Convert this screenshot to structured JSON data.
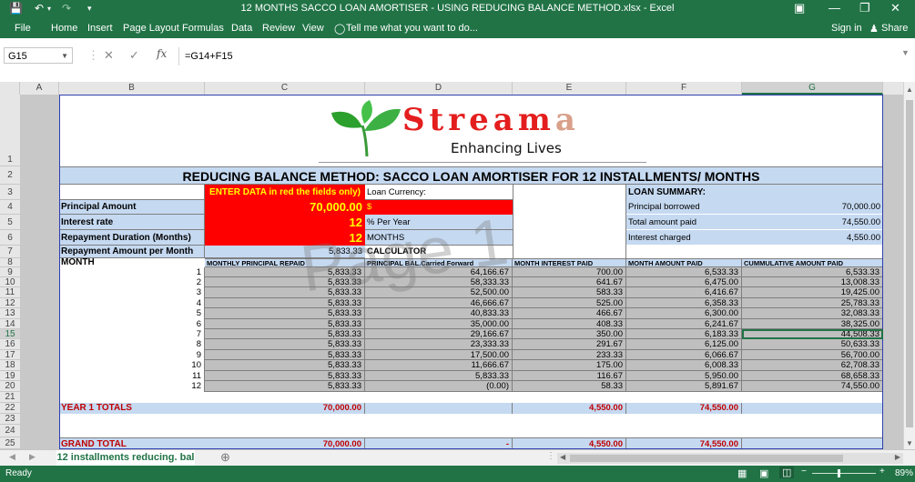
{
  "window": {
    "title": "12 MONTHS SACCO LOAN AMORTISER - USING REDUCING BALANCE METHOD.xlsx - Excel"
  },
  "ribbon": {
    "tabs": [
      "File",
      "Home",
      "Insert",
      "Page Layout",
      "Formulas",
      "Data",
      "Review",
      "View"
    ],
    "tell_me": "Tell me what you want to do...",
    "sign_in": "Sign in",
    "share": "Share"
  },
  "formula_bar": {
    "name_box": "G15",
    "fx": "fx",
    "formula": "=G14+F15"
  },
  "columns": [
    "A",
    "B",
    "C",
    "D",
    "E",
    "F",
    "G"
  ],
  "rows": [
    "1",
    "2",
    "3",
    "4",
    "5",
    "6",
    "7",
    "8",
    "9",
    "10",
    "11",
    "12",
    "13",
    "14",
    "15",
    "16",
    "17",
    "18",
    "19",
    "20",
    "21",
    "22",
    "23",
    "24",
    "25"
  ],
  "logo": {
    "brand": "Stream",
    "brand_tail": "a",
    "tagline": "Enhancing Lives"
  },
  "sheet": {
    "title": "REDUCING BALANCE METHOD: SACCO  LOAN  AMORTISER FOR 12 INSTALLMENTS/ MONTHS",
    "enter_data": "ENTER DATA in red the fields only)",
    "loan_currency": "Loan Currency:",
    "principal_label": "Principal Amount",
    "principal_value": "70,000.00",
    "currency_symbol": "$",
    "interest_label": "Interest rate",
    "interest_value": "12",
    "interest_unit": "% Per Year",
    "duration_label": "Repayment Duration (Months)",
    "duration_value": "12",
    "duration_unit": "MONTHS",
    "repay_label": "Repayment Amount per Month",
    "repay_value": "5,833.33",
    "calculator": "CALCULATOR",
    "summary_title": "LOAN SUMMARY:",
    "summary": [
      {
        "label": "Principal borrowed",
        "value": "70,000.00"
      },
      {
        "label": "Total amount paid",
        "value": "74,550.00"
      },
      {
        "label": "Interest charged",
        "value": "4,550.00"
      }
    ],
    "month_header": "MONTH",
    "headers": [
      "MONTHLY PRINCIPAL REPAID",
      "PRINCIPAL BAL.Carried Forward",
      "MONTH INTEREST PAID",
      "MONTH AMOUNT PAID",
      "CUMMULATIVE AMOUNT PAID"
    ],
    "schedule": [
      [
        "1",
        "5,833.33",
        "64,166.67",
        "700.00",
        "6,533.33",
        "6,533.33"
      ],
      [
        "2",
        "5,833.33",
        "58,333.33",
        "641.67",
        "6,475.00",
        "13,008.33"
      ],
      [
        "3",
        "5,833.33",
        "52,500.00",
        "583.33",
        "6,416.67",
        "19,425.00"
      ],
      [
        "4",
        "5,833.33",
        "46,666.67",
        "525.00",
        "6,358.33",
        "25,783.33"
      ],
      [
        "5",
        "5,833.33",
        "40,833.33",
        "466.67",
        "6,300.00",
        "32,083.33"
      ],
      [
        "6",
        "5,833.33",
        "35,000.00",
        "408.33",
        "6,241.67",
        "38,325.00"
      ],
      [
        "7",
        "5,833.33",
        "29,166.67",
        "350.00",
        "6,183.33",
        "44,508.33"
      ],
      [
        "8",
        "5,833.33",
        "23,333.33",
        "291.67",
        "6,125.00",
        "50,633.33"
      ],
      [
        "9",
        "5,833.33",
        "17,500.00",
        "233.33",
        "6,066.67",
        "56,700.00"
      ],
      [
        "10",
        "5,833.33",
        "11,666.67",
        "175.00",
        "6,008.33",
        "62,708.33"
      ],
      [
        "11",
        "5,833.33",
        "5,833.33",
        "116.67",
        "5,950.00",
        "68,658.33"
      ],
      [
        "12",
        "5,833.33",
        "(0.00)",
        "58.33",
        "5,891.67",
        "74,550.00"
      ]
    ],
    "year_totals": {
      "label": "YEAR 1 TOTALS",
      "principal": "70,000.00",
      "interest": "4,550.00",
      "amount": "74,550.00"
    },
    "grand_totals": {
      "label": "GRAND TOTAL",
      "principal": "70,000.00",
      "balance": "-",
      "interest": "4,550.00",
      "amount": "74,550.00"
    },
    "watermark": "Page 1"
  },
  "sheet_tab": "12 installments reducing. bal",
  "status": {
    "mode": "Ready",
    "zoom": "89%"
  },
  "colors": {
    "excel_green": "#217346",
    "light_blue": "#c5d9f1",
    "input_red": "#ff0000",
    "gray": "#bfbfbf"
  }
}
